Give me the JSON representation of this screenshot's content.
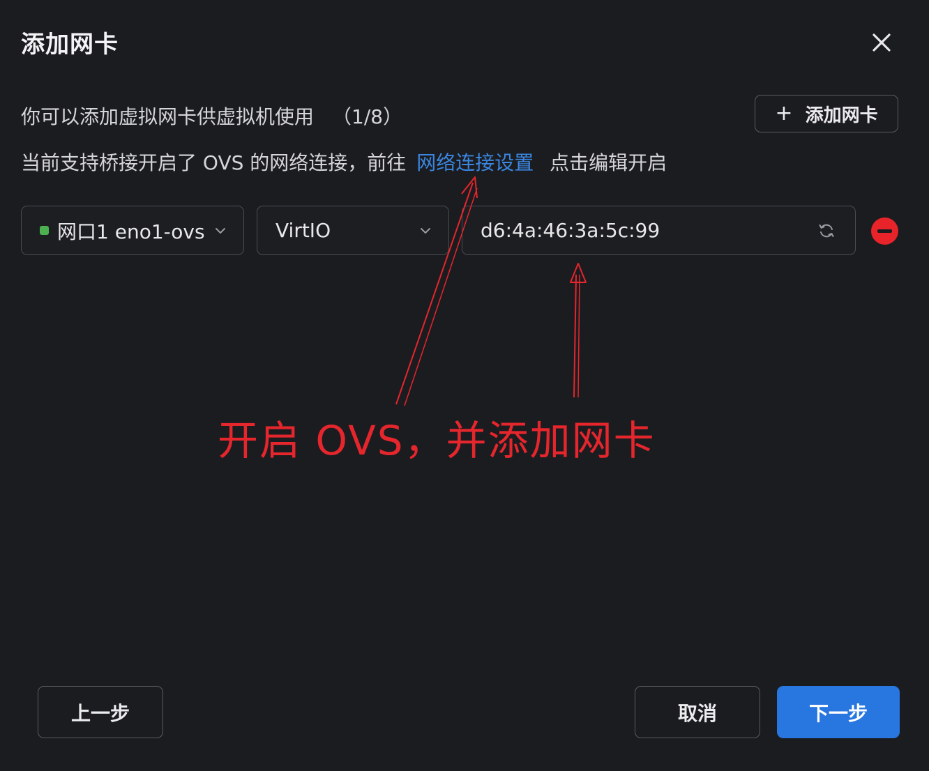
{
  "dialog": {
    "title": "添加网卡",
    "close_icon": "close-icon"
  },
  "description": {
    "text": "你可以添加虚拟网卡供虚拟机使用",
    "count": "（1/8）"
  },
  "notice": {
    "prefix": "当前支持桥接开启了 OVS 的网络连接，前往",
    "link": "网络连接设置",
    "suffix": "点击编辑开启"
  },
  "add_button": {
    "icon": "plus-icon",
    "label": "添加网卡"
  },
  "nic_row": {
    "port": {
      "value": "网口1 eno1-ovs",
      "status_color": "#4caf50"
    },
    "model": {
      "value": "VirtIO"
    },
    "mac": {
      "value": "d6:4a:46:3a:5c:99",
      "refresh_icon": "refresh-icon"
    },
    "remove_icon": "remove-circle-icon",
    "remove_color": "#e8232a"
  },
  "annotation": {
    "text": "开启 OVS，并添加网卡",
    "color": "#e5262c"
  },
  "footer": {
    "prev_label": "上一步",
    "cancel_label": "取消",
    "next_label": "下一步",
    "accent": "#2876e0"
  }
}
